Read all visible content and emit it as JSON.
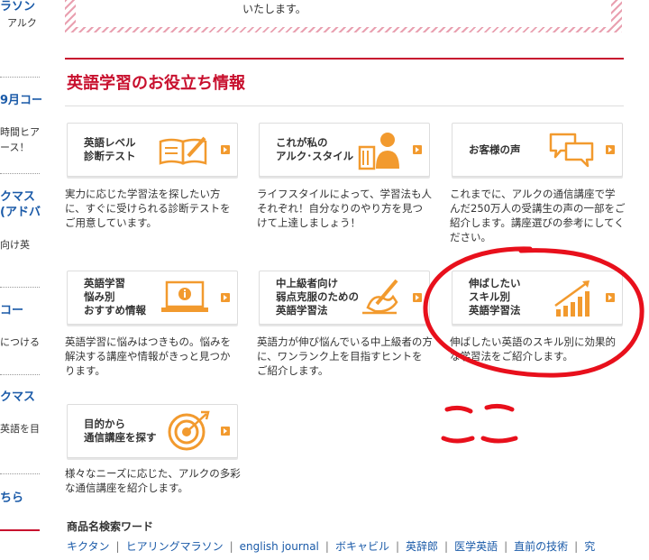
{
  "sidebar": {
    "items": [
      {
        "text": "ラソン",
        "style": "blue"
      },
      {
        "text": "アルク",
        "style": "dark"
      },
      {
        "text": "9月コー",
        "style": "blue"
      },
      {
        "text": "時間ヒア",
        "style": "dark"
      },
      {
        "text": "ース！",
        "style": "dark"
      },
      {
        "text": "クマス",
        "style": "blue"
      },
      {
        "text": "(アドバ",
        "style": "blue"
      },
      {
        "text": "向け英",
        "style": "dark"
      },
      {
        "text": "コー",
        "style": "blue"
      },
      {
        "text": "につける",
        "style": "dark"
      },
      {
        "text": "クマス",
        "style": "blue"
      },
      {
        "text": "英語を目",
        "style": "dark"
      },
      {
        "text": "ちら",
        "style": "blue"
      }
    ]
  },
  "notice": {
    "text": "いたします。"
  },
  "section": {
    "title": "英語学習のお役立ち情報"
  },
  "cards": [
    {
      "label": "英語レベル\n診断テスト",
      "icon": "book-pencil-icon",
      "desc": "実力に応じた学習法を探したい方に、すぐに受けられる診断テストをご用意しています。"
    },
    {
      "label": "これが私の\nアルク･スタイル",
      "icon": "person-books-icon",
      "desc": "ライフスタイルによって、学習法も人それぞれ！自分なりのやり方を見つけて上達しましょう！"
    },
    {
      "label": "お客様の声",
      "icon": "speech-bubbles-icon",
      "desc": "これまでに、アルクの通信講座で学んだ250万人の受講生の声の一部をご紹介します。講座選びの参考にしてください。"
    },
    {
      "label": "英語学習\n悩み別\nおすすめ情報",
      "icon": "laptop-info-icon",
      "desc": "英語学習に悩みはつきもの。悩みを解決する講座や情報がきっと見つかります。"
    },
    {
      "label": "中上級者向け\n弱点克服のための\n英語学習法",
      "icon": "hand-writing-icon",
      "desc": "英語力が伸び悩んでいる中上級者の方に、ワンランク上を目指すヒントをご紹介します。"
    },
    {
      "label": "伸ばしたい\nスキル別\n英語学習法",
      "icon": "growth-chart-icon",
      "desc": "伸ばしたい英語のスキル別に効果的な学習法をご紹介します。"
    },
    {
      "label": "目的から\n通信講座を探す",
      "icon": "target-icon",
      "desc": "様々なニーズに応じた、アルクの多彩な通信講座を紹介します。"
    }
  ],
  "search": {
    "label": "商品名検索ワード",
    "links": [
      "キクタン",
      "ヒアリングマラソン",
      "english journal",
      "ボキャビル",
      "英辞郎",
      "医学英語",
      "直前の技術",
      "究"
    ]
  },
  "annotation": {
    "text": "ここ",
    "color": "#e8101c"
  },
  "colors": {
    "accent_red": "#c8102e",
    "icon_orange": "#f29a2e",
    "link_blue": "#1a5aa8"
  }
}
